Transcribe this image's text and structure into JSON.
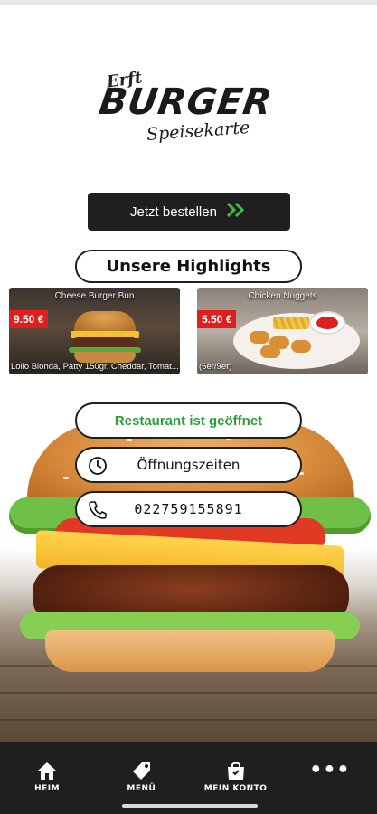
{
  "logo": {
    "line1": "Erft",
    "line2": "BURGER",
    "line3": "Speisekarte"
  },
  "order_button": {
    "label": "Jetzt bestellen",
    "icon": "double-chevron-right-icon",
    "icon_color": "#3dbb4a"
  },
  "highlights": {
    "title": "Unsere Highlights",
    "items": [
      {
        "title": "Cheese Burger Bun",
        "price": "9.50 €",
        "description": "Lollo Bionda, Patty 150gr. Cheddar, Tomat..."
      },
      {
        "title": "Chicken Nuggets",
        "price": "5.50 €",
        "description": "(6er/9er)"
      }
    ]
  },
  "restaurant": {
    "status": "Restaurant ist geöffnet",
    "status_color": "#2e9e3c",
    "hours_label": "Öffnungszeiten",
    "hours_icon": "clock-icon",
    "phone": "022759155891",
    "phone_icon": "phone-icon"
  },
  "bottom_nav": {
    "items": [
      {
        "label": "HEIM",
        "icon": "home-icon"
      },
      {
        "label": "MENÜ",
        "icon": "tag-icon"
      },
      {
        "label": "MEIN KONTO",
        "icon": "shopping-bag-icon"
      },
      {
        "label": "",
        "icon": "more-dots-icon"
      }
    ]
  },
  "colors": {
    "dark": "#1f1f1f",
    "price_badge": "#e11d1d"
  }
}
